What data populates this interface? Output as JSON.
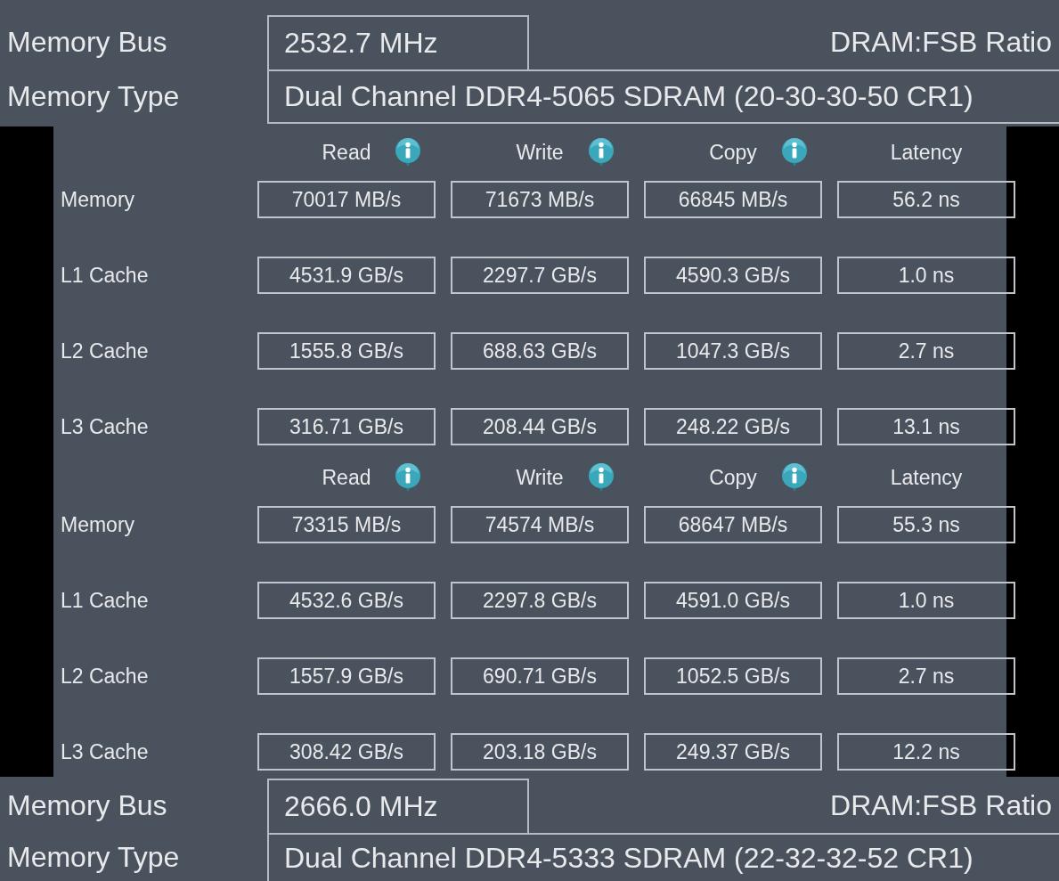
{
  "panels": [
    {
      "kind": "memory_info",
      "rows": [
        {
          "label": "Memory Bus",
          "value": "2532.7 MHz",
          "side_label": "DRAM:FSB Ratio"
        },
        {
          "label": "Memory Type",
          "value": "Dual Channel DDR4-5065 SDRAM (20-30-30-50 CR1)"
        }
      ]
    },
    {
      "kind": "benchmark",
      "columns": [
        {
          "label": "Read",
          "info": true
        },
        {
          "label": "Write",
          "info": true
        },
        {
          "label": "Copy",
          "info": true
        },
        {
          "label": "Latency",
          "info": false
        }
      ],
      "rows": [
        {
          "label": "Memory",
          "values": [
            "70017 MB/s",
            "71673 MB/s",
            "66845 MB/s",
            "56.2 ns"
          ]
        },
        {
          "label": "L1 Cache",
          "values": [
            "4531.9 GB/s",
            "2297.7 GB/s",
            "4590.3 GB/s",
            "1.0 ns"
          ]
        },
        {
          "label": "L2 Cache",
          "values": [
            "1555.8 GB/s",
            "688.63 GB/s",
            "1047.3 GB/s",
            "2.7 ns"
          ]
        },
        {
          "label": "L3 Cache",
          "values": [
            "316.71 GB/s",
            "208.44 GB/s",
            "248.22 GB/s",
            "13.1 ns"
          ]
        }
      ]
    },
    {
      "kind": "benchmark",
      "columns": [
        {
          "label": "Read",
          "info": true
        },
        {
          "label": "Write",
          "info": true
        },
        {
          "label": "Copy",
          "info": true
        },
        {
          "label": "Latency",
          "info": false
        }
      ],
      "rows": [
        {
          "label": "Memory",
          "values": [
            "73315 MB/s",
            "74574 MB/s",
            "68647 MB/s",
            "55.3 ns"
          ]
        },
        {
          "label": "L1 Cache",
          "values": [
            "4532.6 GB/s",
            "2297.8 GB/s",
            "4591.0 GB/s",
            "1.0 ns"
          ]
        },
        {
          "label": "L2 Cache",
          "values": [
            "1557.9 GB/s",
            "690.71 GB/s",
            "1052.5 GB/s",
            "2.7 ns"
          ]
        },
        {
          "label": "L3 Cache",
          "values": [
            "308.42 GB/s",
            "203.18 GB/s",
            "249.37 GB/s",
            "12.2 ns"
          ]
        }
      ]
    },
    {
      "kind": "memory_info",
      "rows": [
        {
          "label": "Memory Bus",
          "value": "2666.0 MHz",
          "side_label": "DRAM:FSB Ratio"
        },
        {
          "label": "Memory Type",
          "value": "Dual Channel DDR4-5333 SDRAM (22-32-32-52 CR1)"
        }
      ]
    }
  ]
}
